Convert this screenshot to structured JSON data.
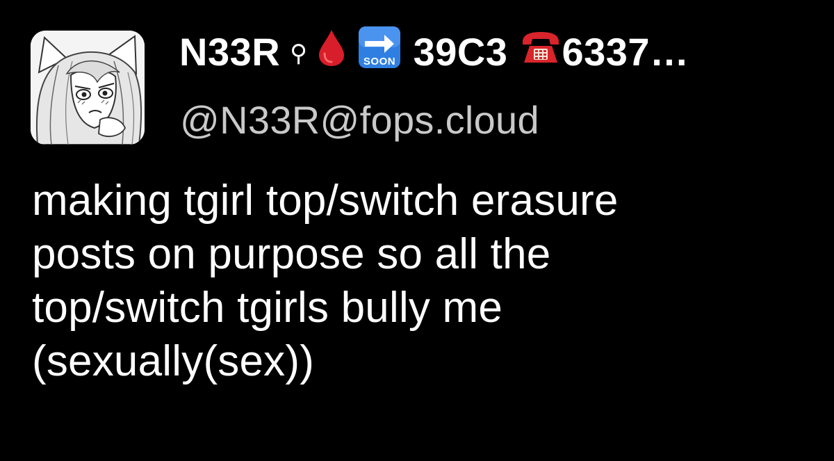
{
  "post": {
    "author": {
      "display_name_parts": {
        "name": "N33R",
        "venus": "⚲",
        "event": "39C3",
        "suffix": "6337…"
      },
      "icons": [
        "blood-drop-icon",
        "soon-arrow-icon",
        "telephone-icon"
      ],
      "soon_label": "SOON",
      "handle": "@N33R@fops.cloud"
    },
    "content_lines": [
      "making tgirl top/switch erasure",
      "posts on purpose so all the",
      "top/switch tgirls bully me",
      "(sexually(sex))"
    ]
  },
  "colors": {
    "background": "#000000",
    "text": "#ffffff",
    "handle": "#c9c9c9",
    "blood": "#d81e2a",
    "soon_blue": "#2f7fe3",
    "phone_red": "#d9242b"
  }
}
